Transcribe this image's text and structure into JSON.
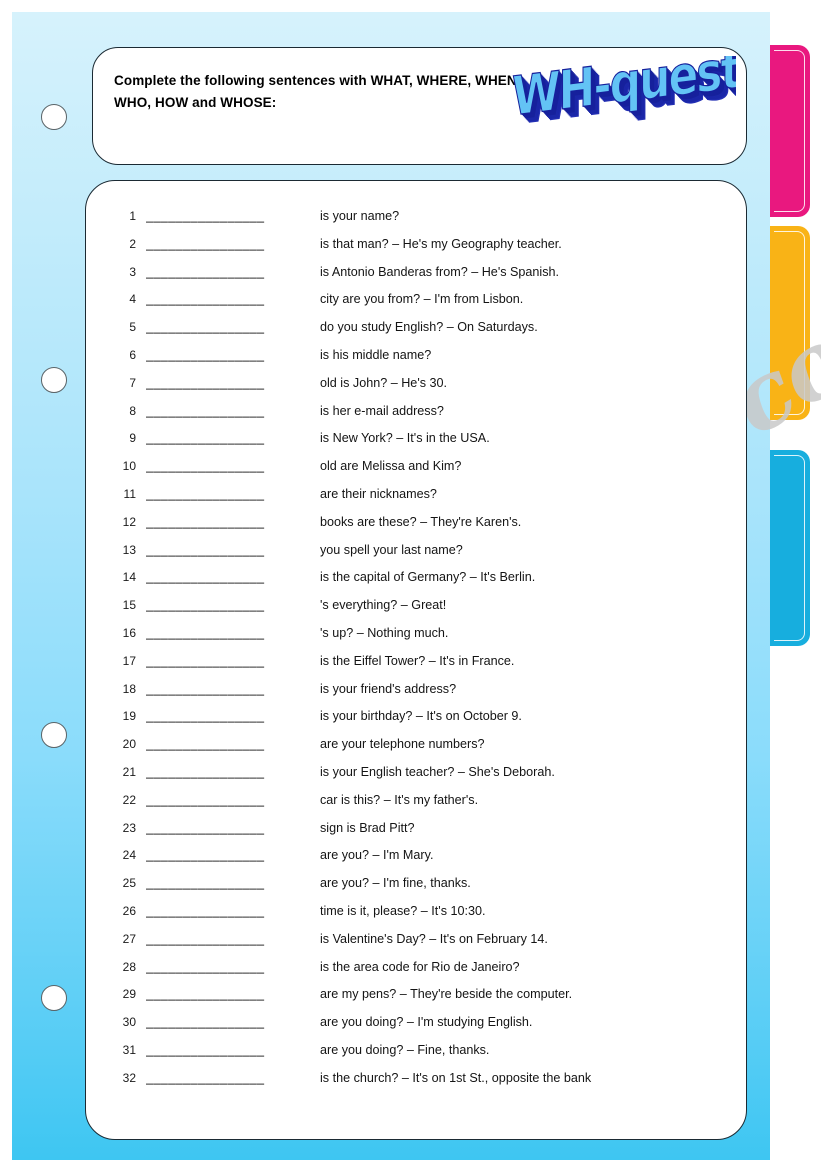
{
  "header": {
    "instructions": "Complete the following sentences with WHAT, WHERE, WHEN, WHO, HOW and WHOSE:",
    "title_art": "WH-questions"
  },
  "watermark": {
    "text": "ESLprintables.com"
  },
  "blank": "________________",
  "exercises": [
    {
      "num": "1",
      "text": "is your name?"
    },
    {
      "num": "2",
      "text": "is that man? – He's my Geography teacher."
    },
    {
      "num": "3",
      "text": "is Antonio Banderas from? – He's Spanish."
    },
    {
      "num": "4",
      "text": "city are you from? – I'm from Lisbon."
    },
    {
      "num": "5",
      "text": "do you study English? – On Saturdays."
    },
    {
      "num": "6",
      "text": "is his middle name?"
    },
    {
      "num": "7",
      "text": "old is John? – He's 30."
    },
    {
      "num": "8",
      "text": "is her e-mail address?"
    },
    {
      "num": "9",
      "text": "is New York? – It's in the USA."
    },
    {
      "num": "10",
      "text": "old are Melissa and Kim?"
    },
    {
      "num": "11",
      "text": "are their nicknames?"
    },
    {
      "num": "12",
      "text": "books are these? – They're Karen's."
    },
    {
      "num": "13",
      "text": "you spell your last name?"
    },
    {
      "num": "14",
      "text": "is the capital of Germany? – It's Berlin."
    },
    {
      "num": "15",
      "text": "'s everything? – Great!"
    },
    {
      "num": "16",
      "text": "'s up? – Nothing much."
    },
    {
      "num": "17",
      "text": "is the Eiffel Tower? – It's in France."
    },
    {
      "num": "18",
      "text": "is your friend's address?"
    },
    {
      "num": "19",
      "text": "is your birthday? – It's on October 9."
    },
    {
      "num": "20",
      "text": "are your telephone numbers?"
    },
    {
      "num": "21",
      "text": "is your English teacher? – She's Deborah."
    },
    {
      "num": "22",
      "text": "car is this? – It's my father's."
    },
    {
      "num": "23",
      "text": "sign is Brad Pitt?"
    },
    {
      "num": "24",
      "text": "are you? – I'm Mary."
    },
    {
      "num": "25",
      "text": "are you? – I'm fine, thanks."
    },
    {
      "num": "26",
      "text": "time is it, please? – It's 10:30."
    },
    {
      "num": "27",
      "text": "is Valentine's Day? – It's on February 14."
    },
    {
      "num": "28",
      "text": "is the area code for Rio de Janeiro?"
    },
    {
      "num": "29",
      "text": "are my pens? – They're beside the computer."
    },
    {
      "num": "30",
      "text": "are you doing? – I'm studying English."
    },
    {
      "num": "31",
      "text": "are you doing? – Fine, thanks."
    },
    {
      "num": "32",
      "text": "is the church? – It's on 1st St., opposite the bank"
    }
  ],
  "tabs": [
    {
      "name": "pink",
      "color": "#e9187f"
    },
    {
      "name": "amber",
      "color": "#f9b316"
    },
    {
      "name": "cyan",
      "color": "#17aede"
    }
  ],
  "binder_holes": 4
}
